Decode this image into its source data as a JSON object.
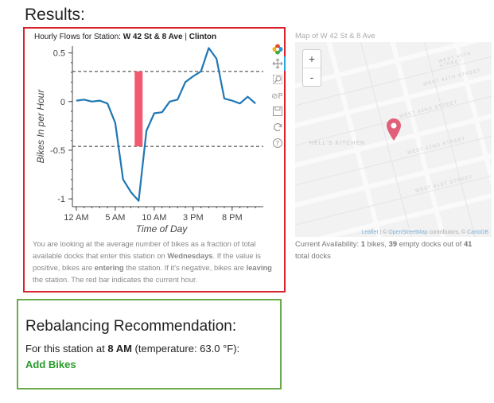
{
  "page": {
    "results_heading": "Results:"
  },
  "chart_panel": {
    "title_prefix": "Hourly Flows for Station: ",
    "station_name": "W 42 St & 8 Ave",
    "separator": " | ",
    "neighborhood": "Clinton",
    "caption": {
      "p1": "You are looking at the average number of bikes as a fraction of total available docks that enter this station on ",
      "day": "Wednesdays",
      "p2": ". If the value is positive, bikes are ",
      "entering": "entering",
      "p3": " the station. If it's negative, bikes are ",
      "leaving": "leaving",
      "p4": " the station. The red bar indicates the current hour."
    },
    "toolbar": [
      "bokeh-logo-icon",
      "pan-icon",
      "zoom-icon",
      "reset-icon",
      "save-icon",
      "refresh-icon",
      "help-icon"
    ]
  },
  "chart_data": {
    "type": "line",
    "xlabel": "Time of Day",
    "ylabel": "Bikes In per Hour",
    "x_ticks": [
      {
        "hour": 0,
        "label": "12 AM"
      },
      {
        "hour": 5,
        "label": "5 AM"
      },
      {
        "hour": 10,
        "label": "10 AM"
      },
      {
        "hour": 15,
        "label": "3 PM"
      },
      {
        "hour": 20,
        "label": "8 PM"
      }
    ],
    "y_ticks": [
      0.5,
      0,
      -0.5,
      -1
    ],
    "y_tick_labels": [
      "0.5",
      "0",
      "-0.5",
      "-1"
    ],
    "xlim": [
      -0.5,
      24
    ],
    "ylim": [
      -1.08,
      0.57
    ],
    "series": [
      {
        "color": "#1f77b4",
        "x": [
          0,
          1,
          2,
          3,
          4,
          5,
          6,
          7,
          8,
          9,
          10,
          11,
          12,
          13,
          14,
          15,
          16,
          17,
          18,
          19,
          20,
          21,
          22,
          23
        ],
        "y": [
          0.01,
          0.02,
          0,
          0.01,
          -0.02,
          -0.22,
          -0.8,
          -0.93,
          -1.02,
          -0.3,
          -0.12,
          -0.11,
          0,
          0.02,
          0.2,
          0.26,
          0.31,
          0.55,
          0.44,
          0.03,
          0.01,
          -0.02,
          0.05,
          -0.02
        ]
      }
    ],
    "reference_lines": [
      0.31,
      -0.46
    ],
    "current_hour_bar": {
      "hour": 8,
      "from": -0.46,
      "to": 0.31,
      "color": "#f25a70"
    }
  },
  "map_panel": {
    "label": "Map of W 42 St & 8 Ave",
    "zoom_in": "+",
    "zoom_out": "-",
    "street_labels": [
      "HELL'S KITCHEN",
      "WEST 44TH STREET",
      "WEST 43RD STREET",
      "WEST 42ND STREET",
      "WEST 41ST STREET",
      "WEST 45TH STREET"
    ],
    "attribution_leaflet": "Leaflet",
    "attribution_osm": "OpenStreetMap",
    "attribution_contributors": " contributors, © ",
    "attribution_carto": "CartoDB",
    "attribution_sep": " | © "
  },
  "availability": {
    "prefix": "Current Availability: ",
    "bikes": "1",
    "bikes_label": " bikes, ",
    "docks": "39",
    "docks_label": " empty docks out of ",
    "total": "41",
    "total_label": " total docks"
  },
  "rebalancing": {
    "title": "Rebalancing Recommendation:",
    "text_prefix": "For this station at ",
    "time": "8 AM",
    "text_suffix": " (temperature: 63.0 °F):",
    "action": "Add Bikes",
    "action_color": "#2a9a2a"
  }
}
